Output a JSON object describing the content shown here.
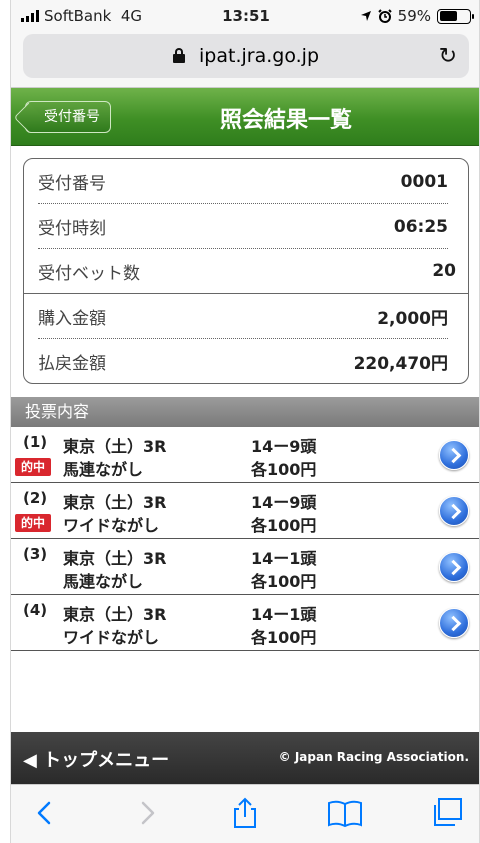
{
  "status": {
    "carrier": "SoftBank",
    "network": "4G",
    "time": "13:51",
    "battery": "59%"
  },
  "browser": {
    "url": "ipat.jra.go.jp",
    "reload": "↻"
  },
  "header": {
    "back_label": "受付番号",
    "title": "照会結果一覧"
  },
  "summary": [
    {
      "label": "受付番号",
      "value": "0001"
    },
    {
      "label": "受付時刻",
      "value": "06:25"
    },
    {
      "label": "受付ベット数",
      "value": "20"
    },
    {
      "label": "購入金額",
      "value": "2,000円"
    },
    {
      "label": "払戻金額",
      "value": "220,470円"
    }
  ],
  "section_title": "投票内容",
  "items": [
    {
      "num": "(1)",
      "race": "東京（土）3R",
      "bet": "馬連ながし",
      "combo": "14ー9頭",
      "amount": "各100円",
      "badge": "的中"
    },
    {
      "num": "(2)",
      "race": "東京（土）3R",
      "bet": "ワイドながし",
      "combo": "14ー9頭",
      "amount": "各100円",
      "badge": "的中"
    },
    {
      "num": "(3)",
      "race": "東京（土）3R",
      "bet": "馬連ながし",
      "combo": "14ー1頭",
      "amount": "各100円"
    },
    {
      "num": "(4)",
      "race": "東京（土）3R",
      "bet": "ワイドながし",
      "combo": "14ー1頭",
      "amount": "各100円"
    }
  ],
  "footer": {
    "home": "◀ トップメニュー",
    "copyright": "© Japan Racing Association."
  },
  "colors": {
    "header_green": "#3f8f25",
    "hit_red": "#d9272e",
    "arrow_blue": "#2f6fdc",
    "ios_blue": "#007aff"
  }
}
